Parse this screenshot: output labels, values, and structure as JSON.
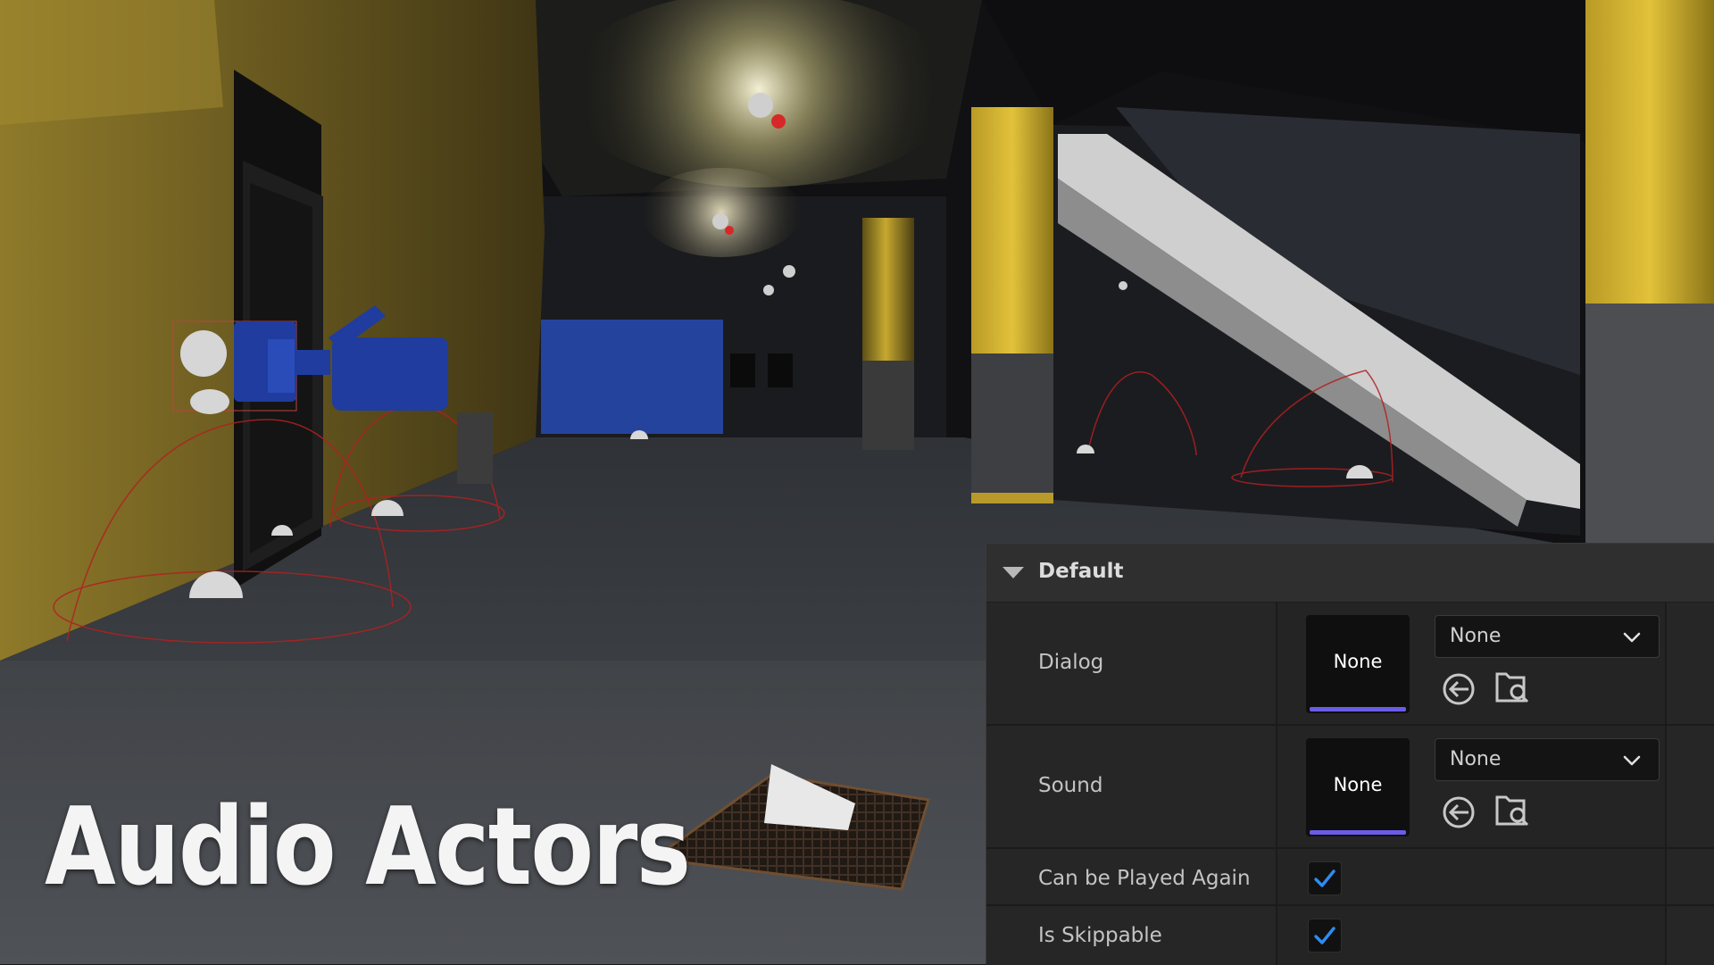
{
  "overlay": {
    "title": "Audio Actors"
  },
  "details_panel": {
    "section": {
      "label": "Default",
      "expanded": true
    },
    "properties": {
      "dialog": {
        "label": "Dialog",
        "thumbnail_label": "None",
        "selected_value": "None"
      },
      "sound": {
        "label": "Sound",
        "thumbnail_label": "None",
        "selected_value": "None"
      },
      "can_be_played_again": {
        "label": "Can be Played Again",
        "checked": true
      },
      "is_skippable": {
        "label": "Is Skippable",
        "checked": true
      }
    },
    "icons": {
      "use_selected": "arrow-left-circle-icon",
      "browse": "folder-search-icon",
      "dropdown": "chevron-down-icon",
      "check": "checkmark-icon",
      "collapse": "triangle-down-icon"
    },
    "colors": {
      "accent_bar": "#6b5ce8",
      "checkmark": "#2f8cf0",
      "panel_bg": "#242424"
    }
  }
}
